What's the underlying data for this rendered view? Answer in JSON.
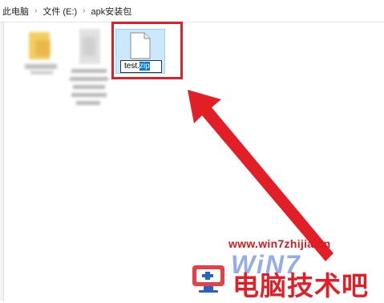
{
  "breadcrumb": {
    "items": [
      "此电脑",
      "文件 (E:)",
      "apk安装包"
    ],
    "separator": "›"
  },
  "files": {
    "selected": {
      "name_prefix": "test.",
      "name_selected": "zip"
    }
  },
  "watermark": {
    "url": "www.win7zhijia.cn",
    "brand": "WiN7",
    "title": "电脑技术吧"
  },
  "colors": {
    "highlight": "#e21f26",
    "selection_bg": "#cce8ff",
    "text_selection": "#0078d7"
  }
}
